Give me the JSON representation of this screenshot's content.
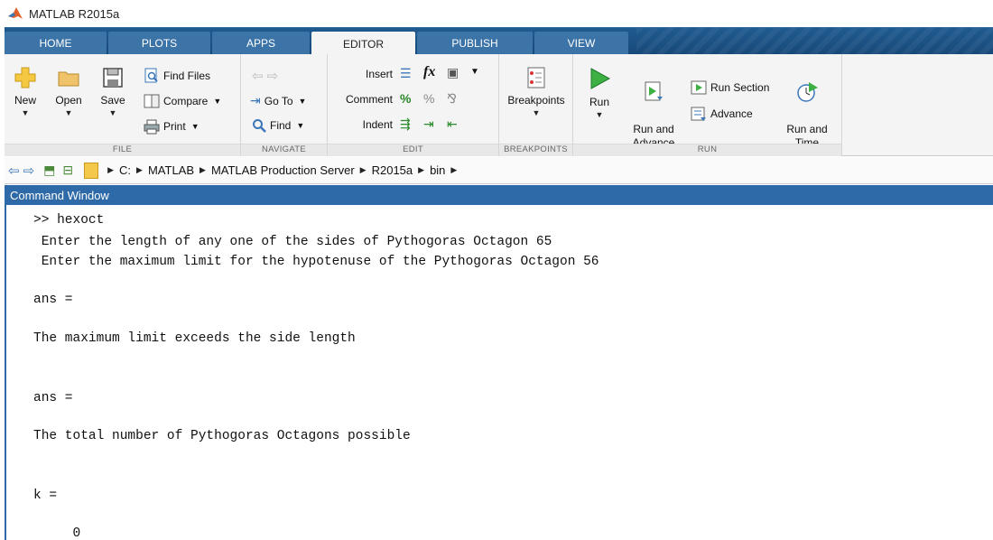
{
  "window": {
    "title": "MATLAB R2015a",
    "logo_icon": "matlab-logo-icon"
  },
  "tabs": [
    {
      "label": "HOME",
      "active": false
    },
    {
      "label": "PLOTS",
      "active": false
    },
    {
      "label": "APPS",
      "active": false
    },
    {
      "label": "EDITOR",
      "active": true
    },
    {
      "label": "PUBLISH",
      "active": false
    },
    {
      "label": "VIEW",
      "active": false
    }
  ],
  "ribbon": {
    "file": {
      "group_label": "FILE",
      "new_label": "New",
      "open_label": "Open",
      "save_label": "Save",
      "find_files_label": "Find Files",
      "compare_label": "Compare",
      "print_label": "Print"
    },
    "navigate": {
      "group_label": "NAVIGATE",
      "goto_label": "Go To",
      "find_label": "Find"
    },
    "edit": {
      "group_label": "EDIT",
      "insert_label": "Insert",
      "comment_label": "Comment",
      "indent_label": "Indent",
      "fx_label": "fx"
    },
    "breakpoints": {
      "group_label": "BREAKPOINTS",
      "breakpoints_label": "Breakpoints"
    },
    "run": {
      "group_label": "RUN",
      "run_label": "Run",
      "run_and_advance_label": "Run and\nAdvance",
      "run_section_label": "Run Section",
      "advance_label": "Advance",
      "run_and_time_label": "Run and\nTime"
    }
  },
  "address_bar": {
    "path": [
      "C:",
      "MATLAB",
      "MATLAB Production Server",
      "R2015a",
      "bin"
    ]
  },
  "command_window": {
    "title": "Command Window",
    "lines": [
      ">> hexoct",
      " Enter the length of any one of the sides of Pythogoras Octagon 65",
      " Enter the maximum limit for the hypotenuse of the Pythogoras Octagon 56",
      "ans =",
      "The maximum limit exceeds the side length",
      "ans =",
      "The total number of Pythogoras Octagons possible",
      "k =",
      "     0"
    ]
  },
  "colors": {
    "tab_strip": "#1f5a8f",
    "tab": "#3c74a8",
    "command_header": "#2e6aa8",
    "run_green": "#3cb043"
  }
}
